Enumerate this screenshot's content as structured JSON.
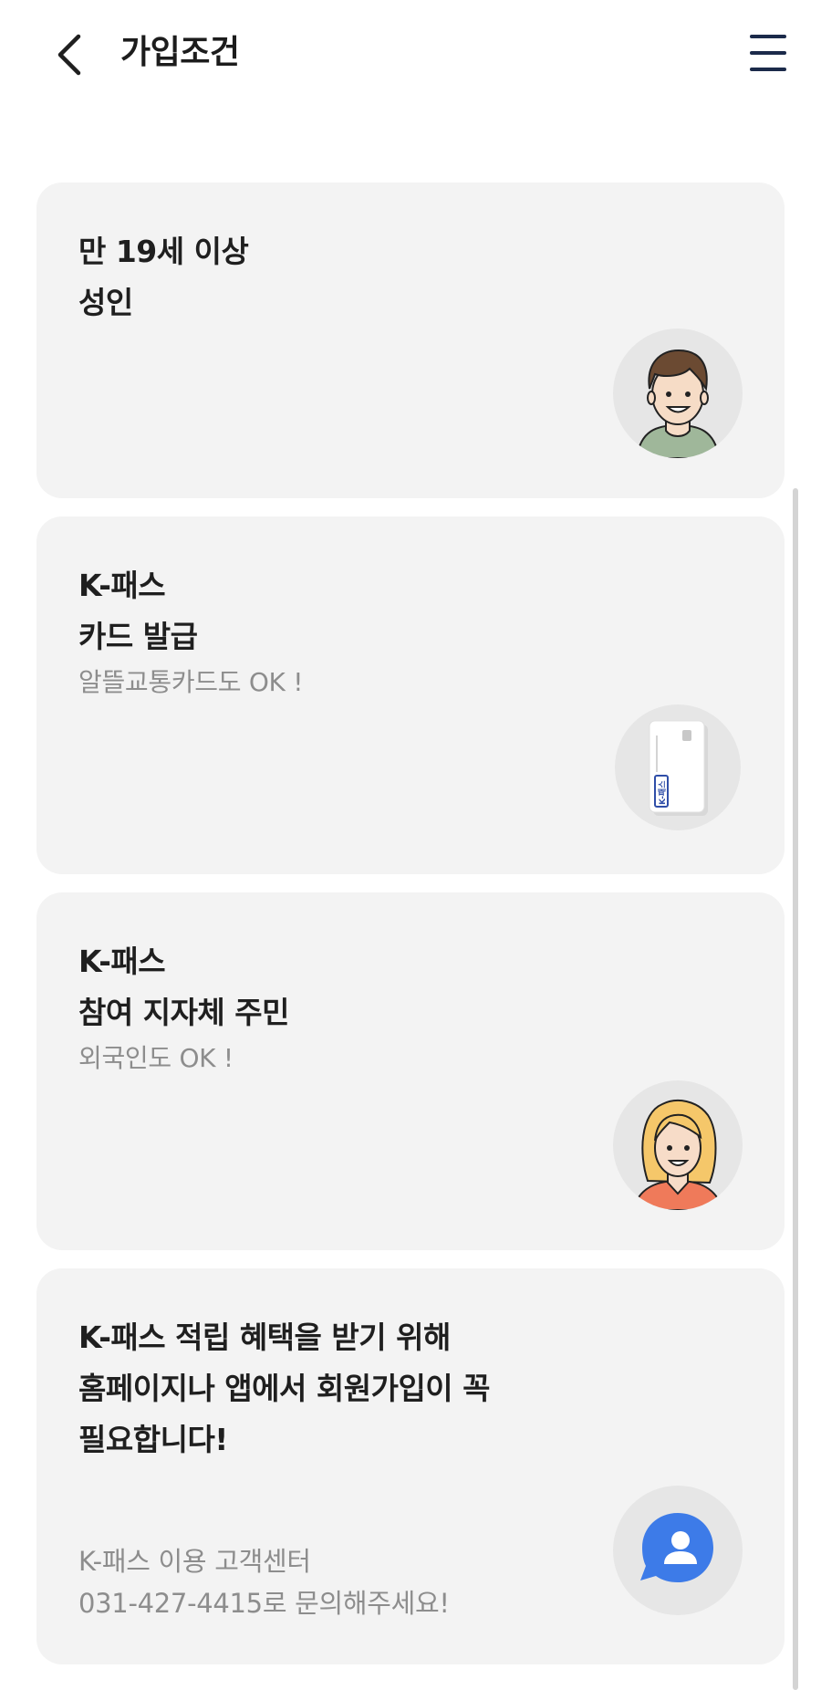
{
  "header": {
    "title": "가입조건"
  },
  "cards": [
    {
      "title_line1": "만 19세 이상",
      "title_line2": "성인",
      "subtitle": ""
    },
    {
      "title_line1": "K-패스",
      "title_line2": "카드 발급",
      "subtitle": "알뜰교통카드도 OK !"
    },
    {
      "title_line1": "K-패스",
      "title_line2": "참여 지자체 주민",
      "subtitle": "외국인도 OK !"
    },
    {
      "title_line1": "K-패스 적립 혜택을 받기 위해",
      "title_line2": "홈페이지나 앱에서 회원가입이 꼭",
      "title_line3": "필요합니다!",
      "contact_line1": "K-패스 이용 고객센터",
      "contact_line2": "031-427-4415로 문의해주세요!"
    }
  ],
  "card_illustration": {
    "text": "K-패스"
  },
  "icons": {
    "back": "chevron-left-icon",
    "menu": "hamburger-menu-icon",
    "adult": "man-avatar-icon",
    "card": "k-pass-card-icon",
    "resident": "woman-avatar-icon",
    "support": "customer-support-chat-icon"
  },
  "colors": {
    "card_bg": "#f3f3f3",
    "circle_bg": "#e6e6e6",
    "title": "#1f1f1f",
    "subtitle": "#8d8d8d",
    "menu_icon": "#1b2a4a",
    "support_blue": "#3d7be8"
  }
}
